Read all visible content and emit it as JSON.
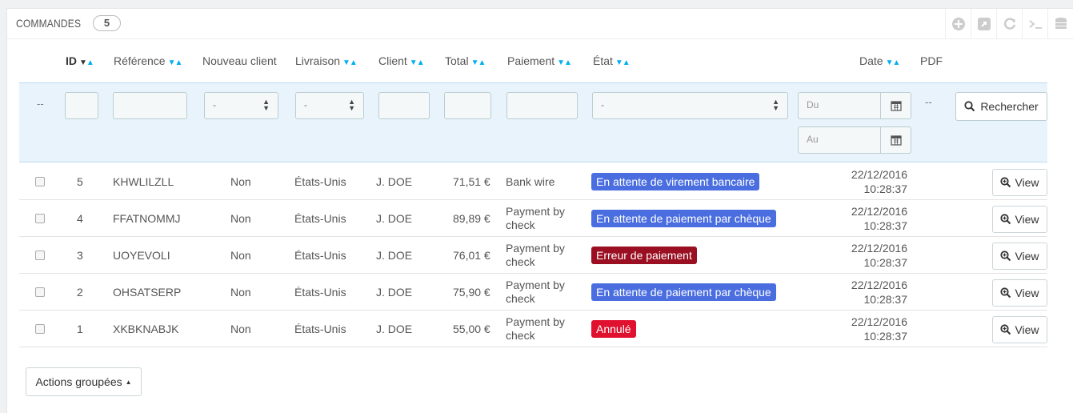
{
  "header": {
    "title": "COMMANDES",
    "count": "5"
  },
  "toolbar": {
    "icons": [
      "add-icon",
      "export-icon",
      "refresh-icon",
      "sql-icon",
      "database-icon"
    ]
  },
  "columns": {
    "id": "ID",
    "reference": "Référence",
    "new_client": "Nouveau client",
    "delivery": "Livraison",
    "client": "Client",
    "total": "Total",
    "payment": "Paiement",
    "state": "État",
    "date": "Date",
    "pdf": "PDF"
  },
  "filters": {
    "dash_left": "--",
    "dash_pdf": "--",
    "new_client_value": "-",
    "delivery_value": "-",
    "state_value": "-",
    "date_from_placeholder": "Du",
    "date_to_placeholder": "Au",
    "search_label": "Rechercher"
  },
  "colors": {
    "blue_badge": "#4a6ee0",
    "darkred_badge": "#9a0f21",
    "red_badge": "#e0102f",
    "sort_active": "#00aff0"
  },
  "rows": [
    {
      "id": "5",
      "reference": "KHWLILZLL",
      "new_client": "Non",
      "delivery": "États-Unis",
      "client": "J. DOE",
      "total": "71,51 €",
      "payment_1": "Bank wire",
      "payment_2": "",
      "state": "En attente de virement bancaire",
      "state_color": "#4a6ee0",
      "date_1": "22/12/2016",
      "date_2": "10:28:37",
      "view": "View"
    },
    {
      "id": "4",
      "reference": "FFATNOMMJ",
      "new_client": "Non",
      "delivery": "États-Unis",
      "client": "J. DOE",
      "total": "89,89 €",
      "payment_1": "Payment by",
      "payment_2": "check",
      "state": "En attente de paiement par chèque",
      "state_color": "#4a6ee0",
      "date_1": "22/12/2016",
      "date_2": "10:28:37",
      "view": "View"
    },
    {
      "id": "3",
      "reference": "UOYEVOLI",
      "new_client": "Non",
      "delivery": "États-Unis",
      "client": "J. DOE",
      "total": "76,01 €",
      "payment_1": "Payment by",
      "payment_2": "check",
      "state": "Erreur de paiement",
      "state_color": "#9a0f21",
      "date_1": "22/12/2016",
      "date_2": "10:28:37",
      "view": "View"
    },
    {
      "id": "2",
      "reference": "OHSATSERP",
      "new_client": "Non",
      "delivery": "États-Unis",
      "client": "J. DOE",
      "total": "75,90 €",
      "payment_1": "Payment by",
      "payment_2": "check",
      "state": "En attente de paiement par chèque",
      "state_color": "#4a6ee0",
      "date_1": "22/12/2016",
      "date_2": "10:28:37",
      "view": "View"
    },
    {
      "id": "1",
      "reference": "XKBKNABJK",
      "new_client": "Non",
      "delivery": "États-Unis",
      "client": "J. DOE",
      "total": "55,00 €",
      "payment_1": "Payment by",
      "payment_2": "check",
      "state": "Annulé",
      "state_color": "#e0102f",
      "date_1": "22/12/2016",
      "date_2": "10:28:37",
      "view": "View"
    }
  ],
  "bulk_actions": "Actions groupées"
}
